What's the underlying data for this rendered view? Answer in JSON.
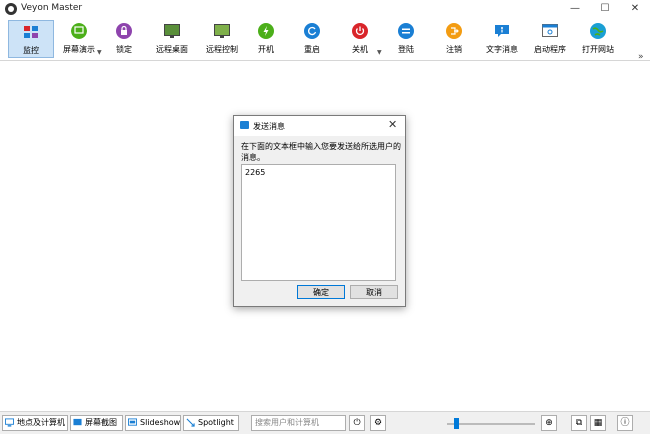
{
  "window": {
    "title": "Veyon Master",
    "controls": {
      "minimize": "—",
      "maximize": "☐",
      "close": "✕"
    }
  },
  "toolbar": {
    "items": [
      {
        "label": "监控",
        "icon": "monitor-icon",
        "active": true
      },
      {
        "label": "屏幕演示",
        "icon": "presentation-icon",
        "dropdown": true
      },
      {
        "label": "锁定",
        "icon": "lock-icon"
      },
      {
        "label": "远程桌面",
        "icon": "remote-desktop-icon"
      },
      {
        "label": "远程控制",
        "icon": "remote-control-icon"
      },
      {
        "label": "开机",
        "icon": "power-on-icon"
      },
      {
        "label": "重启",
        "icon": "reboot-icon"
      },
      {
        "label": "关机",
        "icon": "power-off-icon",
        "dropdown": true
      },
      {
        "label": "登陆",
        "icon": "login-icon"
      },
      {
        "label": "注销",
        "icon": "logout-icon"
      },
      {
        "label": "文字消息",
        "icon": "text-message-icon"
      },
      {
        "label": "启动程序",
        "icon": "start-program-icon"
      },
      {
        "label": "打开网站",
        "icon": "open-website-icon"
      }
    ],
    "overflow": "»"
  },
  "dialog": {
    "title": "发送消息",
    "prompt": "在下面的文本框中输入您要发送给所选用户的消息。",
    "message_value": "2265",
    "ok_label": "确定",
    "cancel_label": "取消",
    "close_glyph": "✕"
  },
  "statusbar": {
    "buttons": [
      {
        "label": "地点及计算机",
        "icon": "locations-icon"
      },
      {
        "label": "屏幕截图",
        "icon": "screenshot-icon"
      },
      {
        "label": "Slideshow",
        "icon": "slideshow-icon"
      },
      {
        "label": "Spotlight",
        "icon": "spotlight-icon"
      }
    ],
    "search_placeholder": "搜索用户和计算机"
  },
  "colors": {
    "accent": "#0078d7",
    "active_bg": "#cde3f7",
    "green": "#4caf1a",
    "purple": "#8e44ad",
    "red": "#d9252a",
    "blue": "#1a7fd4",
    "orange": "#f39c12"
  }
}
